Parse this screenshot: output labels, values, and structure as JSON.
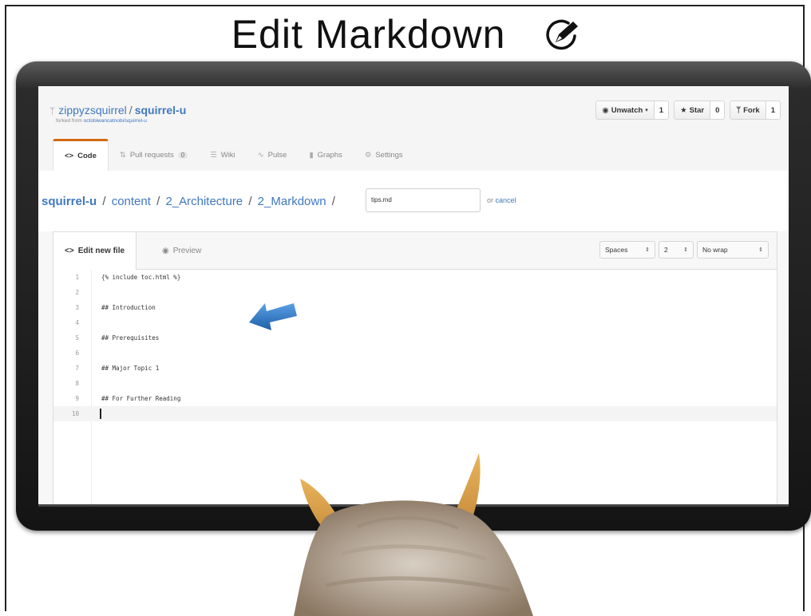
{
  "slide": {
    "title": "Edit Markdown"
  },
  "repo": {
    "owner": "zippyzsquirrel",
    "separator": "/",
    "name": "squirrel-u",
    "forked_prefix": "forked from",
    "forked_link": "octobiwancatnobi/squirrel-u"
  },
  "actions": {
    "unwatch_label": "Unwatch",
    "unwatch_count": "1",
    "star_label": "Star",
    "star_count": "0",
    "fork_label": "Fork",
    "fork_count": "1"
  },
  "tabs": [
    {
      "label": "Code",
      "icon": "code-icon"
    },
    {
      "label": "Pull requests",
      "icon": "pull-request-icon",
      "badge": "0"
    },
    {
      "label": "Wiki",
      "icon": "book-icon"
    },
    {
      "label": "Pulse",
      "icon": "pulse-icon"
    },
    {
      "label": "Graphs",
      "icon": "graph-icon"
    },
    {
      "label": "Settings",
      "icon": "gear-icon"
    }
  ],
  "breadcrumb": {
    "root": "squirrel-u",
    "parts": [
      "content",
      "2_Architecture",
      "2_Markdown"
    ],
    "filename_value": "tips.md",
    "or_text": "or",
    "cancel_label": "cancel"
  },
  "editor": {
    "edit_tab_label": "Edit new file",
    "preview_tab_label": "Preview",
    "indent_mode": "Spaces",
    "indent_size": "2",
    "wrap_mode": "No wrap",
    "lines": [
      {
        "num": "1",
        "text": "{% include toc.html %}"
      },
      {
        "num": "2",
        "text": ""
      },
      {
        "num": "3",
        "text": "## Introduction"
      },
      {
        "num": "4",
        "text": ""
      },
      {
        "num": "5",
        "text": "## Prerequisites"
      },
      {
        "num": "6",
        "text": ""
      },
      {
        "num": "7",
        "text": "## Major Topic 1"
      },
      {
        "num": "8",
        "text": ""
      },
      {
        "num": "9",
        "text": "## For Further Reading"
      },
      {
        "num": "10",
        "text": ""
      }
    ],
    "active_line": 10
  },
  "colors": {
    "link": "#4078c0",
    "selected_tab_accent": "#d26911",
    "arrow": "#2f7dc8"
  }
}
